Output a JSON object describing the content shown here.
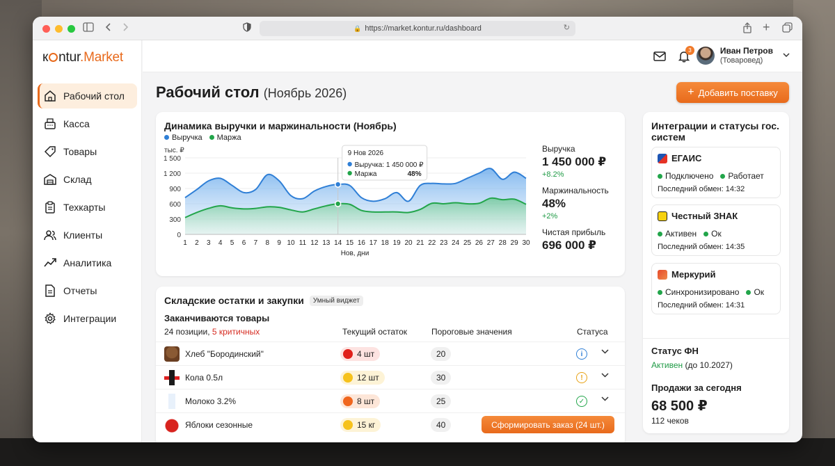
{
  "browser": {
    "url": "https://market.kontur.ru/dashboard"
  },
  "logo": {
    "brand": "kontur",
    "product": ".Market",
    "prefix_k": "k",
    "prefix_o": "o",
    "prefix_rest": "ntur"
  },
  "sidebar": {
    "items": [
      {
        "label": "Рабочий стол",
        "icon": "home-icon",
        "active": true
      },
      {
        "label": "Касса",
        "icon": "cash-register-icon"
      },
      {
        "label": "Товары",
        "icon": "tag-icon"
      },
      {
        "label": "Склад",
        "icon": "warehouse-icon"
      },
      {
        "label": "Техкарты",
        "icon": "clipboard-icon"
      },
      {
        "label": "Клиенты",
        "icon": "users-icon"
      },
      {
        "label": "Аналитика",
        "icon": "trend-icon"
      },
      {
        "label": "Отчеты",
        "icon": "document-icon"
      },
      {
        "label": "Интеграции",
        "icon": "gear-icon"
      }
    ]
  },
  "topbar": {
    "notifications_count": "3",
    "user_name": "Иван Петров",
    "user_role": "(Товаровед)"
  },
  "page": {
    "title": "Рабочий стол",
    "subtitle": "(Ноябрь 2026)",
    "add_button": "Добавить поставку"
  },
  "revenue": {
    "title": "Динамика выручки и маржинальности (Ноябрь)",
    "legend_revenue": "Выручка",
    "legend_margin": "Маржа",
    "revenue_label": "Выручка",
    "revenue_value": "1 450 000 ₽",
    "revenue_delta": "+8.2%",
    "margin_label": "Маржинальность",
    "margin_value": "48%",
    "margin_delta": "+2%",
    "profit_label": "Чистая прибыль",
    "profit_value": "696 000 ₽",
    "tooltip_date": "9 Нов 2026",
    "tooltip_revenue": "Выручка: 1 450 000 ₽",
    "tooltip_margin_label": "Маржа",
    "tooltip_margin_value": "48%"
  },
  "chart_data": {
    "type": "area",
    "title": "Динамика выручки и маржинальности (Ноябрь)",
    "ylabel": "тыс. ₽",
    "xlabel": "Нов, дни",
    "ylim": [
      0,
      1500
    ],
    "yticks": [
      0,
      300,
      600,
      900,
      1200,
      1500
    ],
    "ytick_labels": [
      "0",
      "300",
      "600",
      "900",
      "1 200",
      "1 500"
    ],
    "x": [
      1,
      2,
      3,
      4,
      5,
      6,
      7,
      8,
      9,
      10,
      11,
      12,
      13,
      14,
      15,
      16,
      17,
      18,
      19,
      20,
      21,
      22,
      23,
      24,
      25,
      26,
      27,
      28,
      29,
      30
    ],
    "series": [
      {
        "name": "Выручка",
        "color": "#2f7fd6",
        "values": [
          720,
          880,
          1050,
          1100,
          960,
          820,
          880,
          1170,
          1050,
          760,
          700,
          850,
          940,
          980,
          960,
          720,
          650,
          700,
          820,
          650,
          960,
          1000,
          990,
          1000,
          1100,
          1200,
          1290,
          1080,
          1220,
          1100
        ]
      },
      {
        "name": "Маржа",
        "color": "#22a54a",
        "values": [
          330,
          430,
          510,
          560,
          520,
          500,
          510,
          540,
          530,
          480,
          440,
          500,
          560,
          600,
          590,
          470,
          440,
          440,
          440,
          430,
          490,
          610,
          600,
          620,
          600,
          610,
          710,
          680,
          690,
          590
        ]
      }
    ],
    "tooltip_x": 14
  },
  "stock": {
    "title": "Складские остатки и закупки",
    "smart_badge": "Умный виджет",
    "subtitle": "Заканчиваются товары",
    "count_text": "24 позиции, ",
    "critical_text": "5 критичных",
    "col_current": "Текущий остаток",
    "col_threshold": "Пороговые значения",
    "col_status": "Статуса",
    "rows": [
      {
        "name": "Хлеб \"Бородинский\"",
        "qty": "4 шт",
        "level": "red",
        "threshold": "20",
        "status": "info-icon"
      },
      {
        "name": "Кола 0.5л",
        "qty": "12 шт",
        "level": "yellow",
        "threshold": "30",
        "status": "warning-icon"
      },
      {
        "name": "Молоко 3.2%",
        "qty": "8 шт",
        "level": "orange",
        "threshold": "25",
        "status": "check-icon"
      },
      {
        "name": "Яблоки сезонные",
        "qty": "15 кг",
        "level": "yellow",
        "threshold": "40",
        "status": "order"
      }
    ],
    "order_button": "Сформировать заказ (24 шт.)"
  },
  "integrations": {
    "title": "Интеграции и статусы гос. систем",
    "items": [
      {
        "name": "ЕГАИС",
        "status1": "Подключено",
        "status2": "Работает",
        "last": "Последний обмен: 14:32"
      },
      {
        "name": "Честный ЗНАК",
        "status1": "Активен",
        "status2": "Ок",
        "last": "Последний обмен: 14:35"
      },
      {
        "name": "Меркурий",
        "status1": "Синхронизировано",
        "status2": "Ок",
        "last": "Последний обмен: 14:31"
      }
    ],
    "fn_title": "Статус ФН",
    "fn_status": "Активен",
    "fn_until": "(до 10.2027)",
    "sales_title": "Продажи за сегодня",
    "sales_value": "68 500 ₽",
    "sales_sub": "112 чеков"
  },
  "colors": {
    "accent": "#e86a1c",
    "revenue": "#2f7fd6",
    "margin": "#22a54a",
    "critical": "#d62c22"
  }
}
